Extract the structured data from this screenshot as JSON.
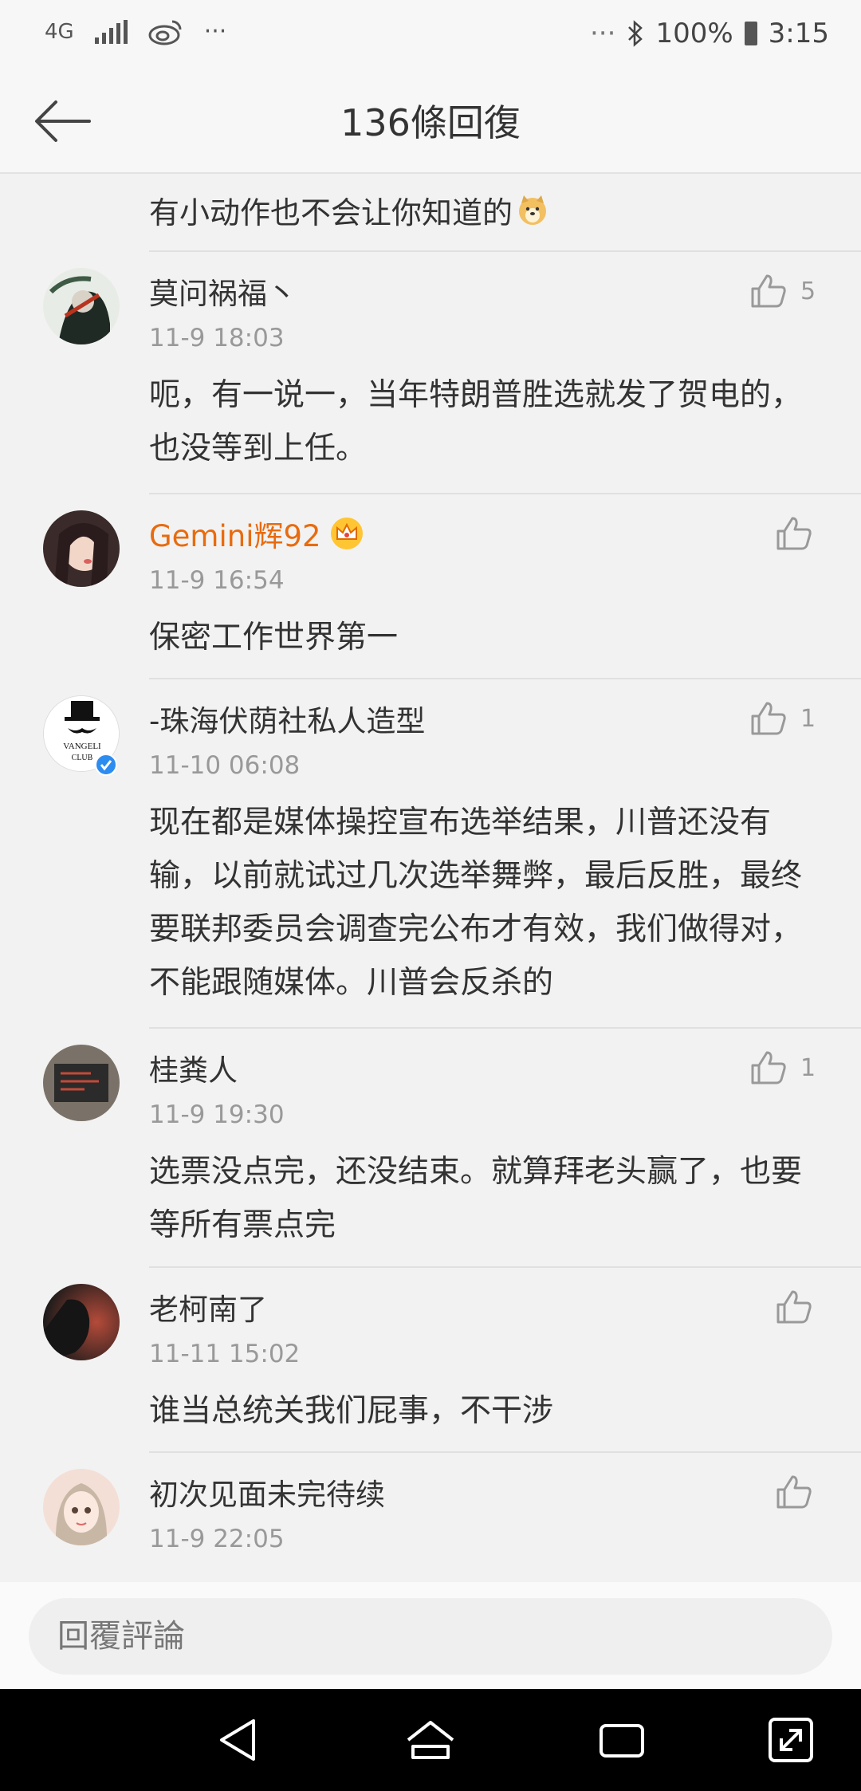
{
  "status": {
    "network": "4G",
    "more": "···",
    "more_right": "···",
    "battery": "100%",
    "time": "3:15"
  },
  "header": {
    "title": "136條回復"
  },
  "partial_comment": {
    "text": "有小动作也不会让你知道的"
  },
  "comments": [
    {
      "name": "莫问祸福丶",
      "time": "11-9 18:03",
      "likes": "5",
      "text": "呃，有一说一，当年特朗普胜选就发了贺电的，也没等到上任。"
    },
    {
      "name": "Gemini辉92",
      "time": "11-9 16:54",
      "likes": "",
      "text": "保密工作世界第一"
    },
    {
      "name": "-珠海伏荫社私人造型",
      "time": "11-10 06:08",
      "likes": "1",
      "text": "现在都是媒体操控宣布选举结果，川普还没有输，以前就试过几次选举舞弊，最后反胜，最终要联邦委员会调查完公布才有效，我们做得对，不能跟随媒体。川普会反杀的"
    },
    {
      "name": "桂粪人",
      "time": "11-9 19:30",
      "likes": "1",
      "text": "选票没点完，还没结束。就算拜老头赢了，也要等所有票点完"
    },
    {
      "name": "老柯南了",
      "time": "11-11 15:02",
      "likes": "",
      "text": "谁当总统关我们屁事，不干涉"
    },
    {
      "name": "初次见面未完待续",
      "time": "11-9 22:05",
      "likes": "",
      "text": ""
    }
  ],
  "avatar_texts": {
    "club_line1": "VANGELI",
    "club_line2": "CLUB"
  },
  "reply": {
    "placeholder": "回覆評論"
  },
  "colors": {
    "vip_name": "#e86b0f",
    "verified": "#2d8cf0"
  }
}
